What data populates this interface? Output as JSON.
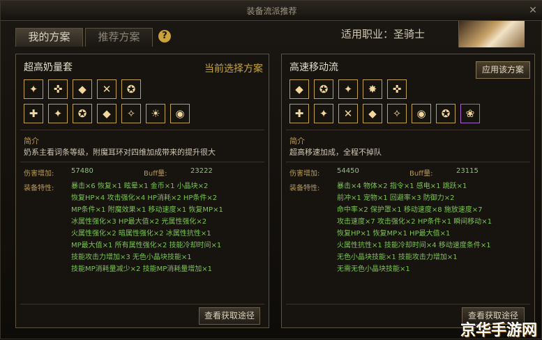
{
  "window": {
    "title": "装备流派推荐"
  },
  "tabs": [
    {
      "label": "我的方案"
    },
    {
      "label": "推荐方案"
    }
  ],
  "help": {
    "label": "?"
  },
  "job": {
    "text": "适用职业：圣骑士"
  },
  "left": {
    "name": "超高奶量套",
    "status": "当前选择方案",
    "icons_row1": [
      "✦",
      "✜",
      "◆",
      "✕",
      "✪",
      "✸"
    ],
    "icons_row2": [
      "✚",
      "✦",
      "✪",
      "◆",
      "✧",
      "☀",
      "◉"
    ],
    "section_label": "简介",
    "description": "奶系主看词条等级，附魔耳环对四维加成带来的提升很大",
    "damage_label": "伤害增加:",
    "damage_value": "57480",
    "buff_label": "Buff量:",
    "buff_value": "23222",
    "traits_label": "装备特性:",
    "traits": [
      "暴击×6  恢复×1  眩晕×1  金币×1  小晶块×2",
      "恢复HP×4  攻击强化×4  HP消耗×2  HP条件×2",
      "MP条件×1  附魔效果×1  移动速度×1  恢复MP×1",
      "冰属性强化×3  HP最大值×2  光属性强化×2",
      "火属性强化×2  暗属性强化×2  冰属性抗性×1",
      "MP最大值×1  所有属性强化×2  技能冷却时间×1",
      "技能攻击力增加×3  无色小晶块技能×1",
      "技能MP消耗量减少×2  技能MP消耗量增加×1"
    ],
    "view_button": "查看获取途径"
  },
  "right": {
    "name": "高速移动流",
    "apply_button": "应用该方案",
    "icons_row1": [
      "◆",
      "✪",
      "✦",
      "✸",
      "✜"
    ],
    "icons_row2": [
      "✚",
      "✦",
      "✕",
      "◆",
      "✧",
      "◉",
      "✪",
      "❀"
    ],
    "section_label": "简介",
    "description": "超高移速加成，全程不掉队",
    "damage_label": "伤害增加:",
    "damage_value": "54450",
    "buff_label": "Buff量:",
    "buff_value": "23115",
    "traits_label": "装备特性:",
    "traits": [
      "暴击×4  物体×2  指令×1  感电×1  跳跃×1",
      "前冲×1  宠物×1  回避率×3  防御力×2",
      "命中率×2  保护罩×1  移动速度×8  施放速度×7",
      "攻击速度×7  攻击强化×2  HP条件×1  瞬间移动×1",
      "恢复HP×1  恢复MP×1  HP最大值×1",
      "火属性抗性×1  技能冷却时间×4  移动速度条件×1",
      "无色小晶块技能×1  技能攻击力增加×1",
      "无需无色小晶块技能×1"
    ],
    "view_button": "查看获取途径"
  },
  "watermark": "京华手游网"
}
